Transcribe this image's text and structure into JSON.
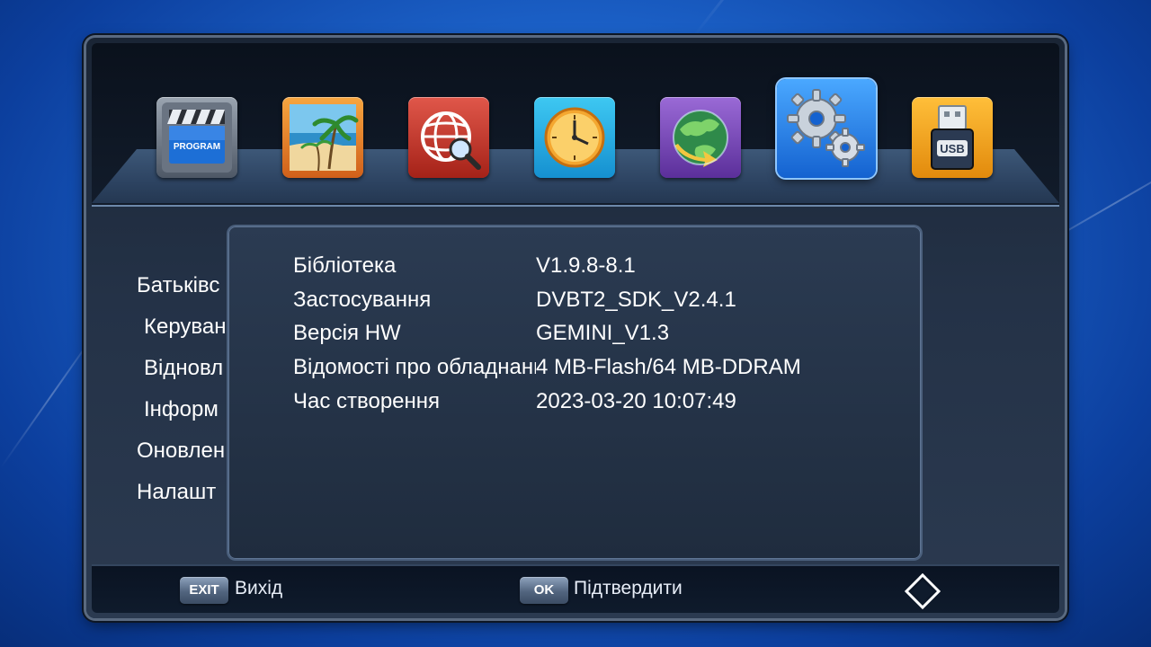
{
  "main_menu": {
    "icons": [
      {
        "name": "program",
        "label": "PROGRAM"
      },
      {
        "name": "picture",
        "label": ""
      },
      {
        "name": "search",
        "label": ""
      },
      {
        "name": "time",
        "label": ""
      },
      {
        "name": "globe",
        "label": ""
      },
      {
        "name": "settings",
        "label": "",
        "selected": true
      },
      {
        "name": "usb",
        "label": "USB"
      }
    ]
  },
  "side_menu": {
    "items": [
      {
        "label": "Батьківс"
      },
      {
        "label": "Керуван"
      },
      {
        "label": "Відновл"
      },
      {
        "label": "Інформ"
      },
      {
        "label": "Оновлен"
      },
      {
        "label": "Налашт"
      }
    ]
  },
  "info": {
    "rows": [
      {
        "key": "Бібліотека",
        "value": "V1.9.8-8.1"
      },
      {
        "key": "Застосування",
        "value": "DVBT2_SDK_V2.4.1"
      },
      {
        "key": "Версія HW",
        "value": "GEMINI_V1.3"
      },
      {
        "key": "Відомості про обладнання",
        "value": "4 MB-Flash/64 MB-DDRAM"
      },
      {
        "key": "Час створення",
        "value": "2023-03-20 10:07:49"
      }
    ]
  },
  "footer": {
    "exit_key": "EXIT",
    "exit_label": "Вихід",
    "ok_key": "OK",
    "ok_label": "Підтвердити"
  },
  "colors": {
    "background": "#1c62c9",
    "panel": "#243247",
    "text": "#ffffff",
    "selected_outline": "#8ec6ff"
  }
}
